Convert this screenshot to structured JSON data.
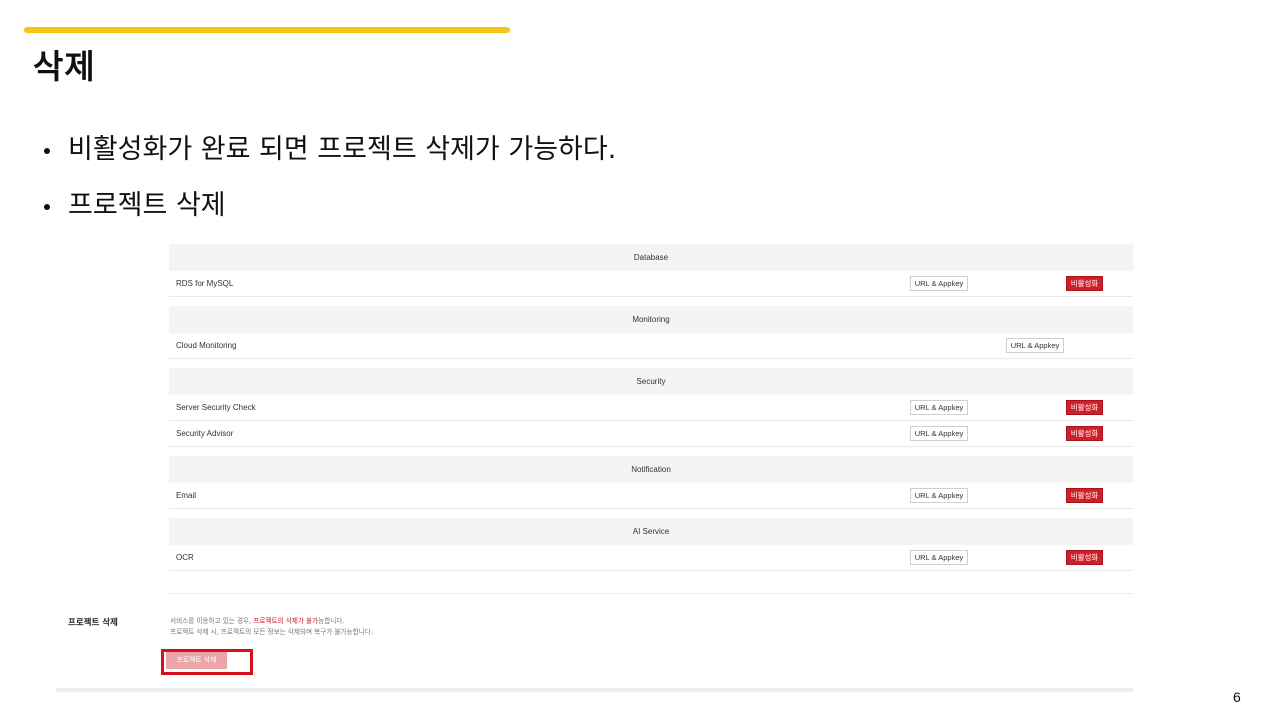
{
  "slide": {
    "title": "삭제",
    "bullets": [
      "비활성화가 완료 되면 프로젝트 삭제가 가능하다.",
      "프로젝트 삭제"
    ],
    "page_number": "6",
    "accent_color": "#f5c518"
  },
  "console": {
    "url_label": "URL & Appkey",
    "deactivate_label": "비활성화",
    "groups": [
      {
        "title": "Database",
        "services": [
          {
            "name": "RDS for MySQL"
          }
        ]
      },
      {
        "title": "Monitoring",
        "services": [
          {
            "name": "Cloud Monitoring"
          }
        ]
      },
      {
        "title": "Security",
        "services": [
          {
            "name": "Server Security Check"
          },
          {
            "name": "Security Advisor"
          }
        ]
      },
      {
        "title": "Notification",
        "services": [
          {
            "name": "Email"
          }
        ]
      },
      {
        "title": "AI Service",
        "services": [
          {
            "name": "OCR"
          }
        ]
      }
    ],
    "delete_section": {
      "label": "프로젝트 삭제",
      "desc_line1_before": "서비스를 이용하고 있는 경우, ",
      "desc_line1_warn": "프로젝트의 삭제가 불가",
      "desc_line1_after": "능합니다.",
      "desc_line2": "프로젝트 삭제 시, 프로젝트의 모든 정보는 삭제되며 복구가 불가능합니다.",
      "button_label": "프로젝트 삭제"
    },
    "colors": {
      "deactivate_red": "#d11f2a",
      "highlight_red": "#d6101c",
      "disabled_delete_pink": "#eba4a8"
    }
  }
}
